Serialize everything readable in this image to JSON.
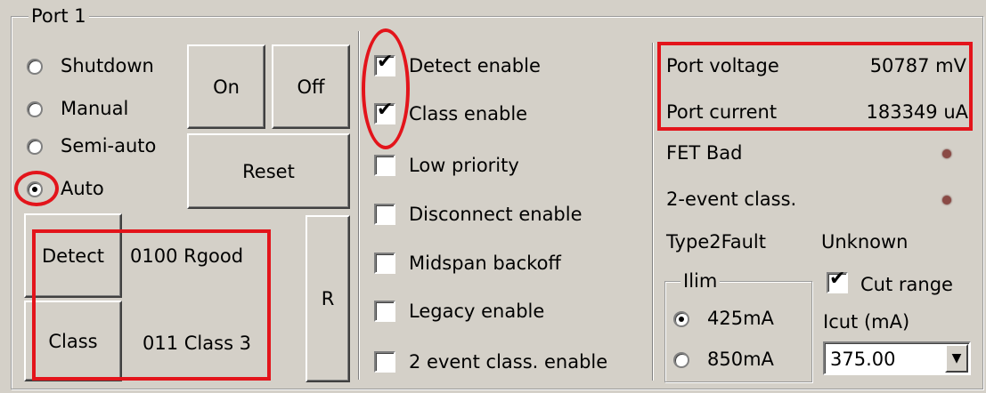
{
  "group_title": "Port 1",
  "mode": {
    "options": [
      "Shutdown",
      "Manual",
      "Semi-auto",
      "Auto"
    ],
    "selected": "Auto"
  },
  "buttons": {
    "on": "On",
    "off": "Off",
    "reset": "Reset",
    "detect": "Detect",
    "class": "Class",
    "r": "R"
  },
  "status": {
    "detect_result": "0100 Rgood",
    "class_result": "011 Class 3"
  },
  "checkboxes": [
    {
      "label": "Detect enable",
      "checked": true
    },
    {
      "label": "Class enable",
      "checked": true
    },
    {
      "label": "Low priority",
      "checked": false
    },
    {
      "label": "Disconnect enable",
      "checked": false
    },
    {
      "label": "Midspan backoff",
      "checked": false
    },
    {
      "label": "Legacy enable",
      "checked": false
    },
    {
      "label": "2 event class. enable",
      "checked": false
    }
  ],
  "measurements": {
    "voltage_label": "Port voltage",
    "voltage_value": "50787 mV",
    "current_label": "Port current",
    "current_value": "183349 uA"
  },
  "indicators": {
    "fet_bad": "FET Bad",
    "two_event": "2-event class."
  },
  "type2fault": {
    "label": "Type2Fault",
    "value": "Unknown"
  },
  "ilim": {
    "title": "Ilim",
    "options": [
      "425mA",
      "850mA"
    ],
    "selected": "425mA"
  },
  "cut_range": {
    "label": "Cut range",
    "checked": true
  },
  "icut": {
    "label": "Icut (mA)",
    "value": "375.00"
  },
  "colors": {
    "panel": "#d4d0c8",
    "annotation": "#e3141b",
    "led": "#8a4a45"
  }
}
